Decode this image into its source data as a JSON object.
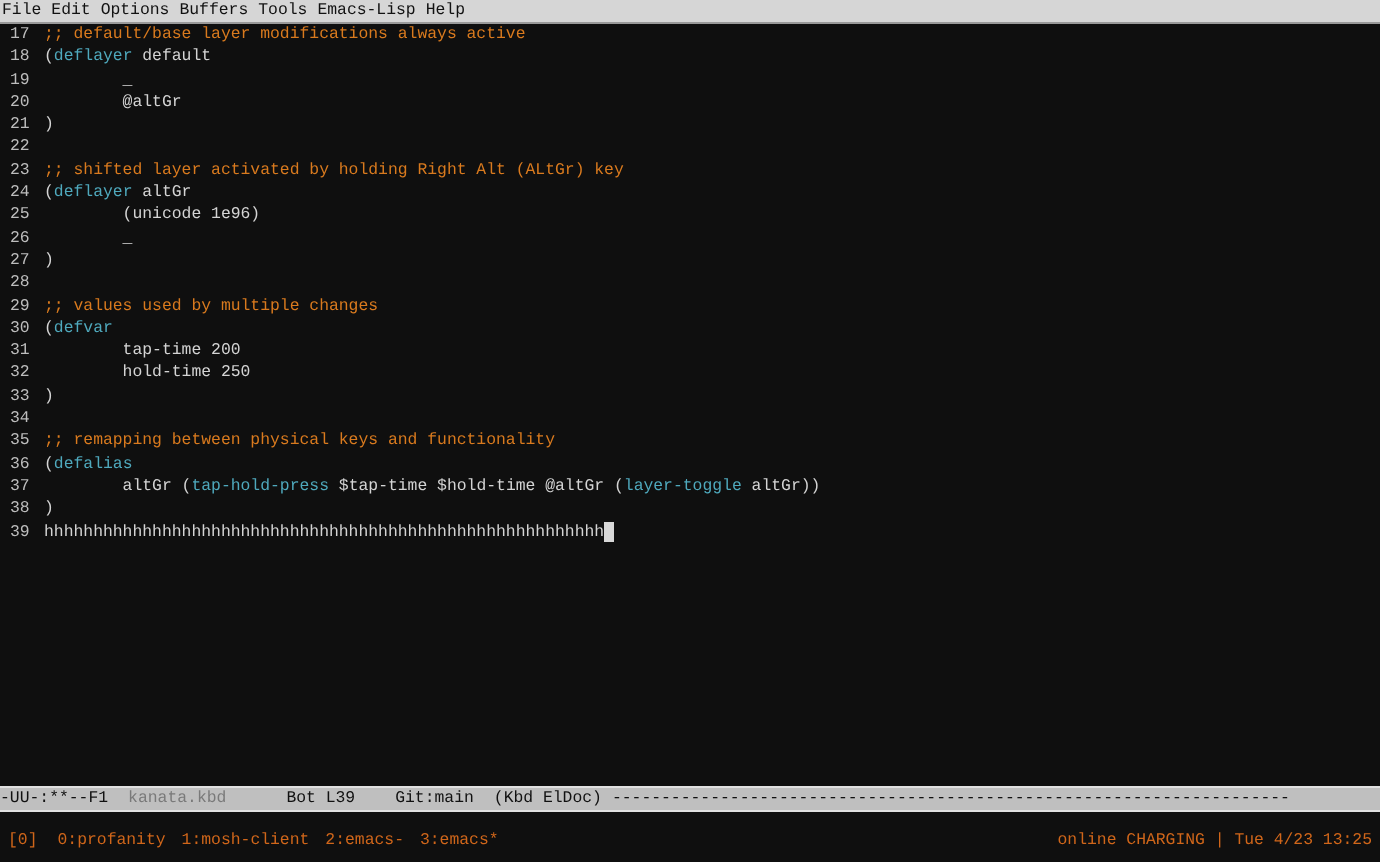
{
  "menu_bar": [
    "File",
    "Edit",
    "Options",
    "Buffers",
    "Tools",
    "Emacs-Lisp",
    "Help"
  ],
  "editor": {
    "lines": [
      {
        "number": "17",
        "segments": [
          {
            "kind": "comment",
            "text": ";; default/base layer modifications always active"
          }
        ]
      },
      {
        "number": "18",
        "segments": [
          {
            "kind": "plain",
            "text": "("
          },
          {
            "kind": "keyword",
            "text": "deflayer"
          },
          {
            "kind": "plain",
            "text": " default"
          }
        ]
      },
      {
        "number": "19",
        "segments": [
          {
            "kind": "plain",
            "text": "        _"
          }
        ]
      },
      {
        "number": "20",
        "segments": [
          {
            "kind": "plain",
            "text": "        @altGr"
          }
        ]
      },
      {
        "number": "21",
        "segments": [
          {
            "kind": "plain",
            "text": ")"
          }
        ]
      },
      {
        "number": "22"
      },
      {
        "number": "23",
        "segments": [
          {
            "kind": "comment",
            "text": ";; shifted layer activated by holding Right Alt (ALtGr) key"
          }
        ]
      },
      {
        "number": "24",
        "segments": [
          {
            "kind": "plain",
            "text": "("
          },
          {
            "kind": "keyword",
            "text": "deflayer"
          },
          {
            "kind": "plain",
            "text": " altGr"
          }
        ]
      },
      {
        "number": "25",
        "segments": [
          {
            "kind": "plain",
            "text": "        (unicode 1e96)"
          }
        ]
      },
      {
        "number": "26",
        "segments": [
          {
            "kind": "plain",
            "text": "        _"
          }
        ]
      },
      {
        "number": "27",
        "segments": [
          {
            "kind": "plain",
            "text": ")"
          }
        ]
      },
      {
        "number": "28"
      },
      {
        "number": "29",
        "segments": [
          {
            "kind": "comment",
            "text": ";; values used by multiple changes"
          }
        ]
      },
      {
        "number": "30",
        "segments": [
          {
            "kind": "plain",
            "text": "("
          },
          {
            "kind": "keyword",
            "text": "defvar"
          }
        ]
      },
      {
        "number": "31",
        "segments": [
          {
            "kind": "plain",
            "text": "        tap-time 200"
          }
        ]
      },
      {
        "number": "32",
        "segments": [
          {
            "kind": "plain",
            "text": "        hold-time 250"
          }
        ]
      },
      {
        "number": "33",
        "segments": [
          {
            "kind": "plain",
            "text": ")"
          }
        ]
      },
      {
        "number": "34"
      },
      {
        "number": "35",
        "segments": [
          {
            "kind": "comment",
            "text": ";; remapping between physical keys and functionality"
          }
        ]
      },
      {
        "number": "36",
        "segments": [
          {
            "kind": "plain",
            "text": "("
          },
          {
            "kind": "keyword",
            "text": "defalias"
          }
        ]
      },
      {
        "number": "37",
        "segments": [
          {
            "kind": "plain",
            "text": "        altGr ("
          },
          {
            "kind": "keyword",
            "text": "tap-hold-press"
          },
          {
            "kind": "plain",
            "text": " $tap-time $hold-time @altGr ("
          },
          {
            "kind": "keyword",
            "text": "layer-toggle"
          },
          {
            "kind": "plain",
            "text": " altGr))"
          }
        ]
      },
      {
        "number": "38",
        "segments": [
          {
            "kind": "plain",
            "text": ")"
          }
        ]
      },
      {
        "number": "39",
        "cursor": true,
        "segments": [
          {
            "kind": "plain",
            "text": "hhhhhhhhhhhhhhhhhhhhhhhhhhhhhhhhhhhhhhhhhhhhhhhhhhhhhhhhh"
          }
        ]
      }
    ]
  },
  "mode_line": {
    "status": "-UU-:**--F1",
    "buffer": "kanata.kbd",
    "position": "Bot L39",
    "branch": "Git:main",
    "modes": "(Kbd ElDoc)",
    "fill": "---------------------------------------------------------------------"
  },
  "tmux_bar": {
    "session": "[0]",
    "windows": [
      "0:profanity",
      "1:mosh-client",
      "2:emacs-",
      "3:emacs*"
    ],
    "status": "online CHARGING | Tue 4/23 13:25"
  }
}
